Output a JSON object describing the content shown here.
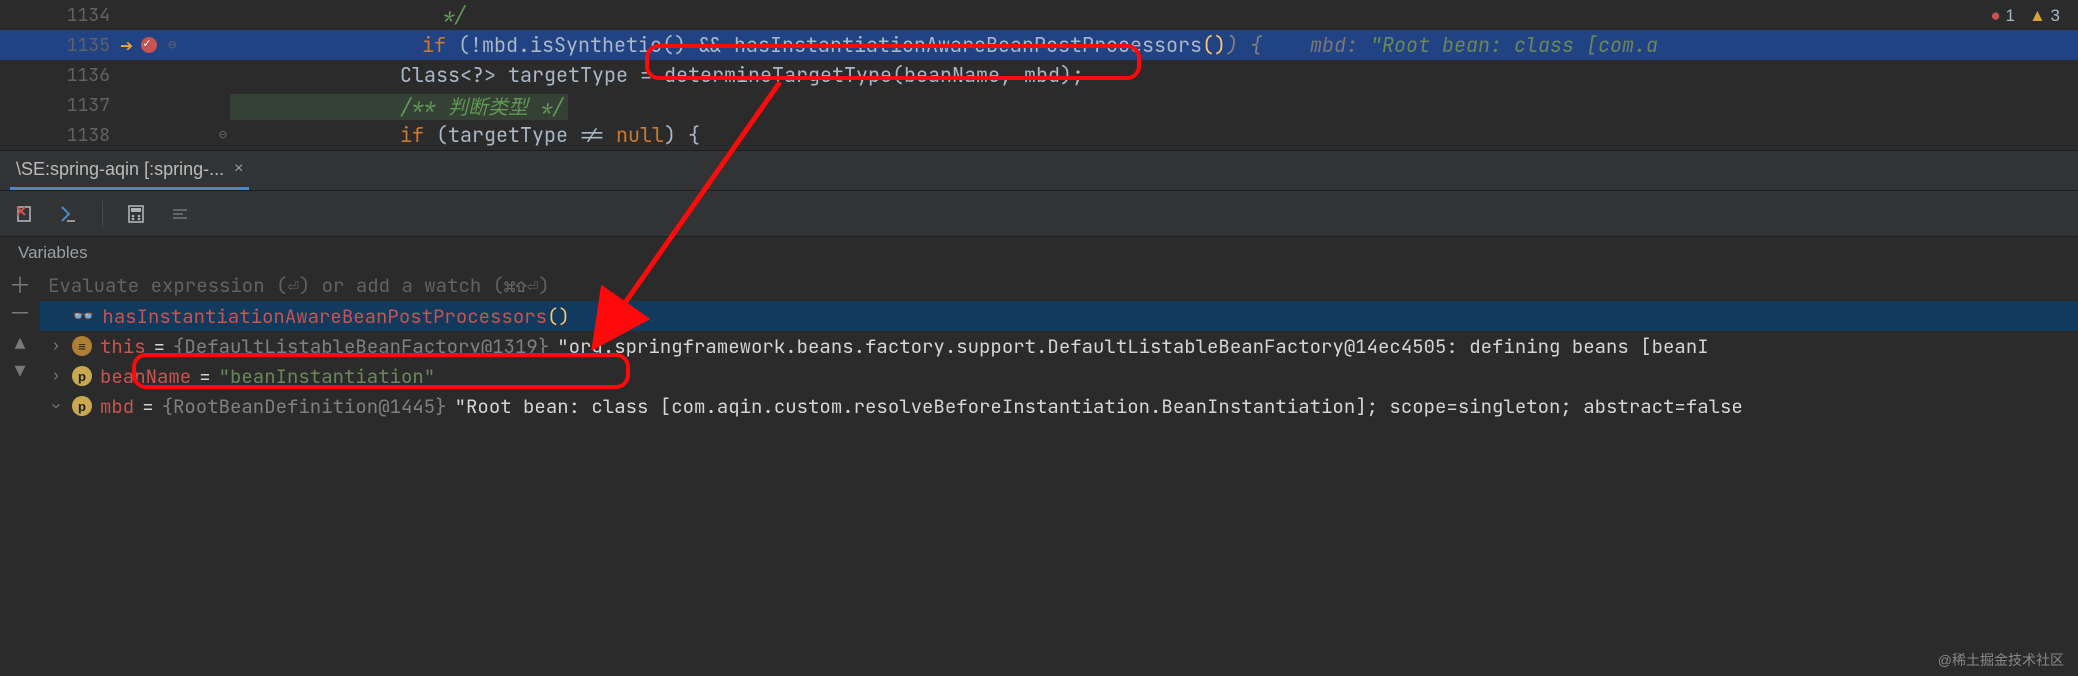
{
  "badges": {
    "errors": "1",
    "warnings": "3"
  },
  "code": {
    "l1134": {
      "n": "1134",
      "c": " */"
    },
    "l1135": {
      "n": "1135",
      "kw": "if ",
      "expr1": "(!mbd.isSynthetic() && ",
      "call": "hasInstantiationAwareBeanPostProcessors",
      "parens": "()",
      "after": ") {    ",
      "inlay_label": "mbd: ",
      "inlay_val": "\"Root bean: class [com.a"
    },
    "l1136": {
      "n": "1136",
      "t": "Class<?> targetType = determineTargetType(beanName, mbd);"
    },
    "l1137": {
      "n": "1137",
      "c": "/** 判断类型 */"
    },
    "l1138": {
      "n": "1138",
      "kw": "if ",
      "rest": "(targetType != ",
      "nul": "null",
      "end": ") {"
    }
  },
  "tab": {
    "label": "\\SE:spring-aqin [:spring-...",
    "close": "×"
  },
  "vars_header": "Variables",
  "eval_placeholder": "Evaluate expression (⏎) or add a watch (⌘⇧⏎)",
  "watch": {
    "name": "hasInstantiationAwareBeanPostProcessors",
    "call": "()"
  },
  "rows": {
    "this": {
      "name": "this",
      "eq": " = ",
      "type": "{DefaultListableBeanFactory@1319} ",
      "val": "\"org.springframework.beans.factory.support.DefaultListableBeanFactory@14ec4505: defining beans [beanI"
    },
    "beanName": {
      "name": "beanName",
      "eq": " = ",
      "val": "\"beanInstantiation\""
    },
    "mbd": {
      "name": "mbd",
      "eq": " = ",
      "type": "{RootBeanDefinition@1445} ",
      "val": "\"Root bean: class [com.aqin.custom.resolveBeforeInstantiation.BeanInstantiation]; scope=singleton; abstract=false"
    }
  },
  "watermark": "@稀土掘金技术社区"
}
